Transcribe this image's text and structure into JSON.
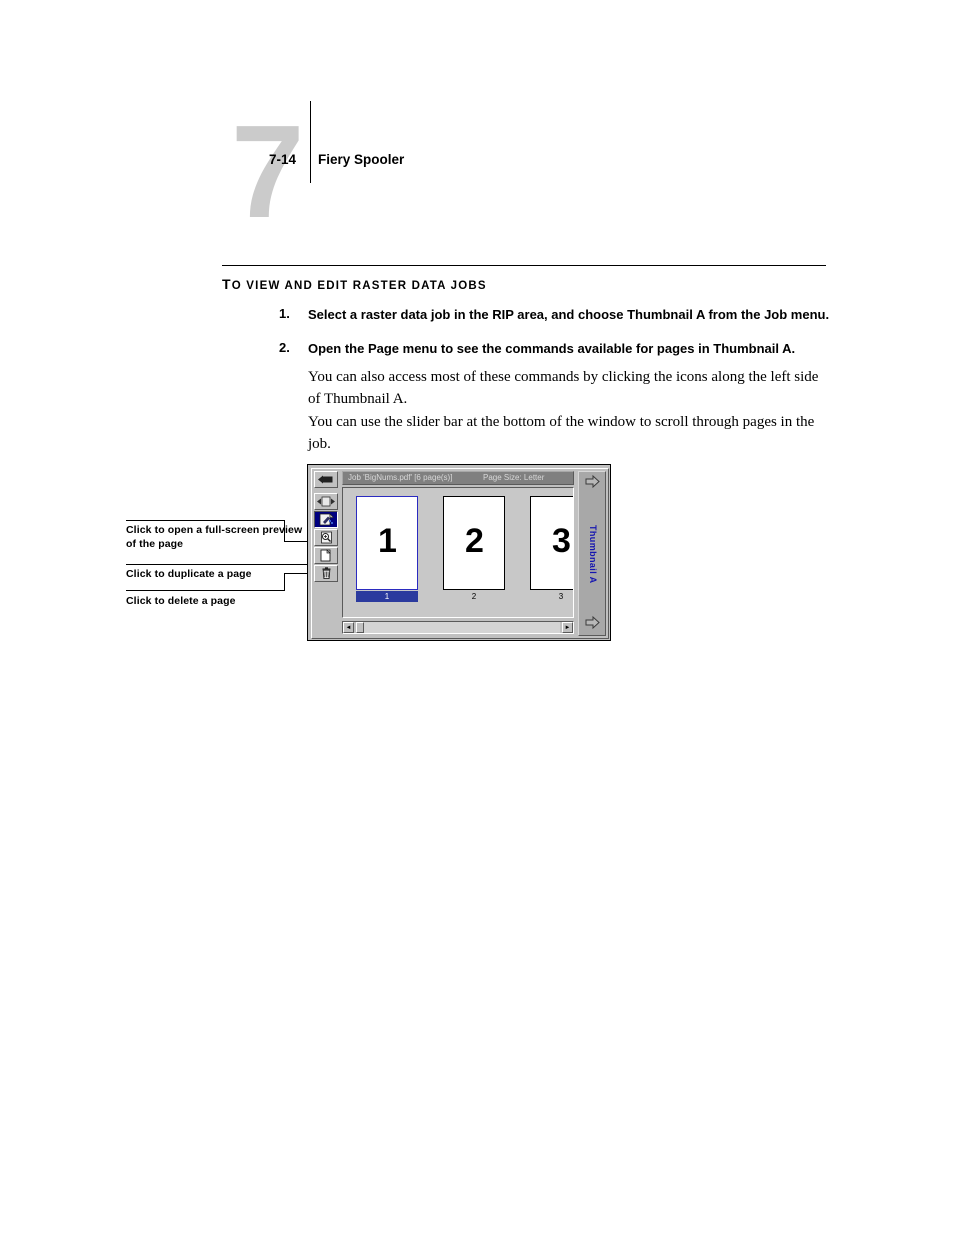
{
  "header": {
    "chapter_numeral": "7",
    "folio": "7-14",
    "running_head": "Fiery Spooler"
  },
  "section": {
    "heading_first_letter": "T",
    "heading_rest": "O VIEW AND EDIT RASTER DATA JOBS"
  },
  "steps": [
    {
      "number": "1.",
      "text": "Select a raster data job in the RIP area, and choose Thumbnail A from the Job menu."
    },
    {
      "number": "2.",
      "text": "Open the Page menu to see the commands available for pages in Thumbnail A."
    }
  ],
  "paragraphs": [
    "You can also access most of these commands by clicking the icons along the left side of Thumbnail A.",
    "You can use the slider bar at the bottom of the window to scroll through pages in the job."
  ],
  "callouts": [
    "Click to open a full-screen preview of the page",
    "Click to duplicate a page",
    "Click to delete a page"
  ],
  "window": {
    "titlebar": {
      "job_label": "Job 'BigNums.pdf' [6 page(s)]",
      "page_size_label": "Page Size: Letter"
    },
    "rail_label": "Thumbnail A",
    "toolbar": [
      {
        "name": "back-arrow-button",
        "tooltip": "Back",
        "selected": false
      },
      {
        "name": "move-page-button",
        "tooltip": "Move page",
        "selected": false
      },
      {
        "name": "edit-page-button",
        "tooltip": "Edit page",
        "selected": true
      },
      {
        "name": "preview-page-button",
        "tooltip": "Full-screen preview",
        "selected": false
      },
      {
        "name": "duplicate-page-button",
        "tooltip": "Duplicate page",
        "selected": false
      },
      {
        "name": "delete-page-button",
        "tooltip": "Delete page",
        "selected": false
      }
    ],
    "pages": [
      {
        "number": "1",
        "caption": "1",
        "selected": true
      },
      {
        "number": "2",
        "caption": "2",
        "selected": false
      },
      {
        "number": "3",
        "caption": "3",
        "selected": false
      }
    ],
    "scrollbar": {
      "left_arrow": "◄",
      "right_arrow": "►"
    }
  },
  "colors": {
    "chapter_numeral_gray": "#cbcbcb",
    "window_face": "#c0c0c0",
    "titlebar_gray": "#808080",
    "selection_blue": "#000080",
    "caption_blue": "#2b3a9e",
    "rail_text_blue": "#1515b0"
  }
}
